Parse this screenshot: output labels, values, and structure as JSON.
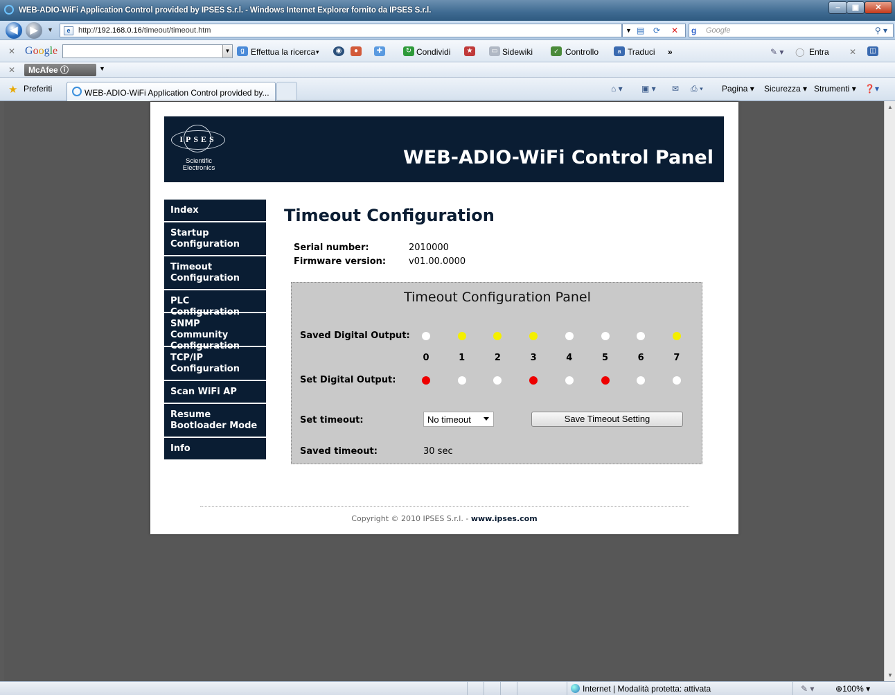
{
  "window": {
    "title": "WEB-ADIO-WiFi Application Control provided by IPSES S.r.l. - Windows Internet Explorer fornito da IPSES S.r.l."
  },
  "addressbar": {
    "url_prefix": "http://",
    "url_host": "192.168.0.16",
    "url_path": "/timeout/timeout.htm",
    "search_placeholder": "Google"
  },
  "google_toolbar": {
    "brand": "Google",
    "items": [
      "Effettua la ricerca",
      "Condividi",
      "Sidewiki",
      "Controllo",
      "Traduci",
      "»",
      "Entra"
    ]
  },
  "mcafee": {
    "label": "McAfee"
  },
  "favorites": {
    "label": "Preferiti",
    "tab_title": "WEB-ADIO-WiFi Application Control provided by...",
    "commands": [
      "Pagina",
      "Sicurezza",
      "Strumenti"
    ]
  },
  "status": {
    "zone": "Internet | Modalità protetta: attivata",
    "zoom": "100%"
  },
  "page": {
    "logo_text": "IPSES",
    "logo_sub_1": "Scientific",
    "logo_sub_2": "Electronics",
    "header_title": "WEB-ADIO-WiFi Control Panel",
    "menu": [
      {
        "label": "Index"
      },
      {
        "label": "Startup Configuration"
      },
      {
        "label": "Timeout Configuration"
      },
      {
        "label": "PLC Configuration"
      },
      {
        "label": "SNMP Community Configuration"
      },
      {
        "label": "TCP/IP Configuration"
      },
      {
        "label": "Scan WiFi AP"
      },
      {
        "label": "Resume Bootloader Mode"
      },
      {
        "label": "Info"
      }
    ],
    "content_title": "Timeout Configuration",
    "serial_label": "Serial number:",
    "serial_value": "2010000",
    "firmware_label": "Firmware version:",
    "firmware_value": "v01.00.0000",
    "panel": {
      "title": "Timeout Configuration Panel",
      "saved_output_label": "Saved Digital Output:",
      "set_output_label": "Set Digital Output:",
      "channels": [
        "0",
        "1",
        "2",
        "3",
        "4",
        "5",
        "6",
        "7"
      ],
      "saved_states": [
        "off",
        "on",
        "on",
        "on",
        "off",
        "off",
        "off",
        "on"
      ],
      "set_states": [
        "on",
        "off",
        "off",
        "on",
        "off",
        "on",
        "off",
        "off"
      ],
      "colors": {
        "saved_on": "#f4ef00",
        "set_on": "#ee0000",
        "off": "#ffffff"
      },
      "set_timeout_label": "Set timeout:",
      "timeout_selected": "No timeout",
      "save_button": "Save Timeout Setting",
      "saved_timeout_label": "Saved timeout:",
      "saved_timeout_value": "30 sec"
    },
    "copyright_prefix": "Copyright © 2010 IPSES S.r.l. - ",
    "copyright_link": "www.ipses.com"
  }
}
